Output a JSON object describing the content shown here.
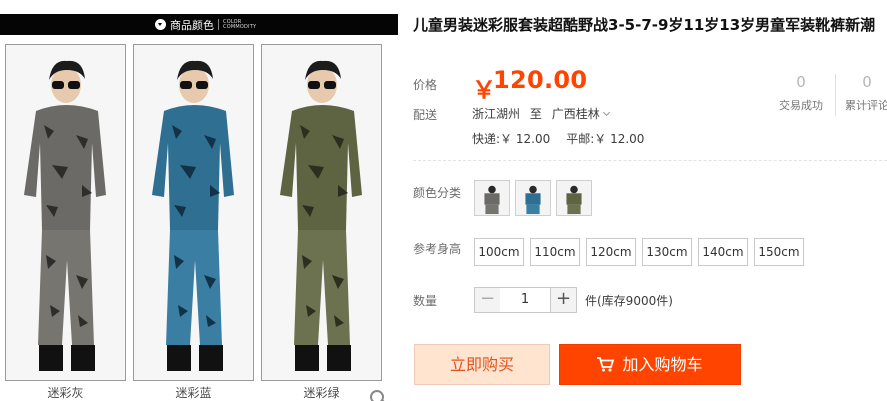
{
  "gallery": {
    "header_cn": "商品颜色",
    "header_en_line1": "COLOR",
    "header_en_line2": "COMMODITY",
    "captions": [
      "迷彩灰",
      "迷彩蓝",
      "迷彩绿"
    ],
    "colors": {
      "gray_camo": "#6b6a66",
      "blue_camo": "#2e6f92",
      "green_camo": "#5e6442"
    }
  },
  "product": {
    "title": "儿童男装迷彩服套装超酷野战3-5-7-9岁11岁13岁男童军装靴裤新潮",
    "price_label": "价格",
    "price_symbol": "￥",
    "price": "120.00",
    "stats": [
      {
        "value": "0",
        "label": "交易成功"
      },
      {
        "value": "0",
        "label": "累计评论"
      }
    ],
    "shipping_label": "配送",
    "ship_from": "浙江湖州",
    "ship_to_word": "至",
    "ship_to": "广西桂林",
    "express_fee": "快递:￥ 12.00",
    "mail_fee": "平邮:￥ 12.00",
    "color_label": "颜色分类",
    "size_label": "参考身高",
    "sizes": [
      "100cm",
      "110cm",
      "120cm",
      "130cm",
      "140cm",
      "150cm"
    ],
    "quantity_label": "数量",
    "quantity_minus": "−",
    "quantity_value": "1",
    "quantity_plus": "+",
    "stock": "件(库存9000件)",
    "buy_now": "立即购买",
    "add_to_cart": "加入购物车",
    "accent_color": "#ff4400"
  }
}
